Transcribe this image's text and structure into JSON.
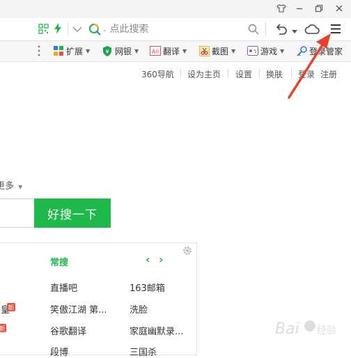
{
  "addressbar": {
    "search_placeholder": "点此搜索"
  },
  "extensions": [
    {
      "label": "扩展",
      "icon": "grid-icon",
      "color": "#2e7bd6"
    },
    {
      "label": "网银",
      "icon": "shield-icon",
      "color": "#1fa34a"
    },
    {
      "label": "翻译",
      "icon": "translate-icon",
      "color": "#d9534f"
    },
    {
      "label": "截图",
      "icon": "scissors-icon",
      "color": "#e89a1a"
    },
    {
      "label": "游戏",
      "icon": "gamepad-icon",
      "color": "#7a5fc0"
    },
    {
      "label": "登录管家",
      "icon": "key-icon",
      "color": "#2e7bd6"
    }
  ],
  "toplinks": [
    "360导航",
    "设为主页",
    "设置",
    "换肤",
    "登录",
    "注册"
  ],
  "search": {
    "more_label": "更多",
    "button_label": "好搜一下"
  },
  "panel": {
    "title": "常搜",
    "prev": "‹",
    "next": "›",
    "col1": [
      "直播吧",
      "笑傲江湖 第...",
      "谷歌翻译",
      "段博"
    ],
    "col2": [
      "163邮箱",
      "洗脸",
      "家庭幽默录...",
      "三国杀"
    ],
    "left_edge": [
      "皇",
      "新"
    ],
    "badge_text": "新"
  },
  "colors": {
    "accent_green": "#1fb84a",
    "arrow_red": "#e8402a"
  }
}
